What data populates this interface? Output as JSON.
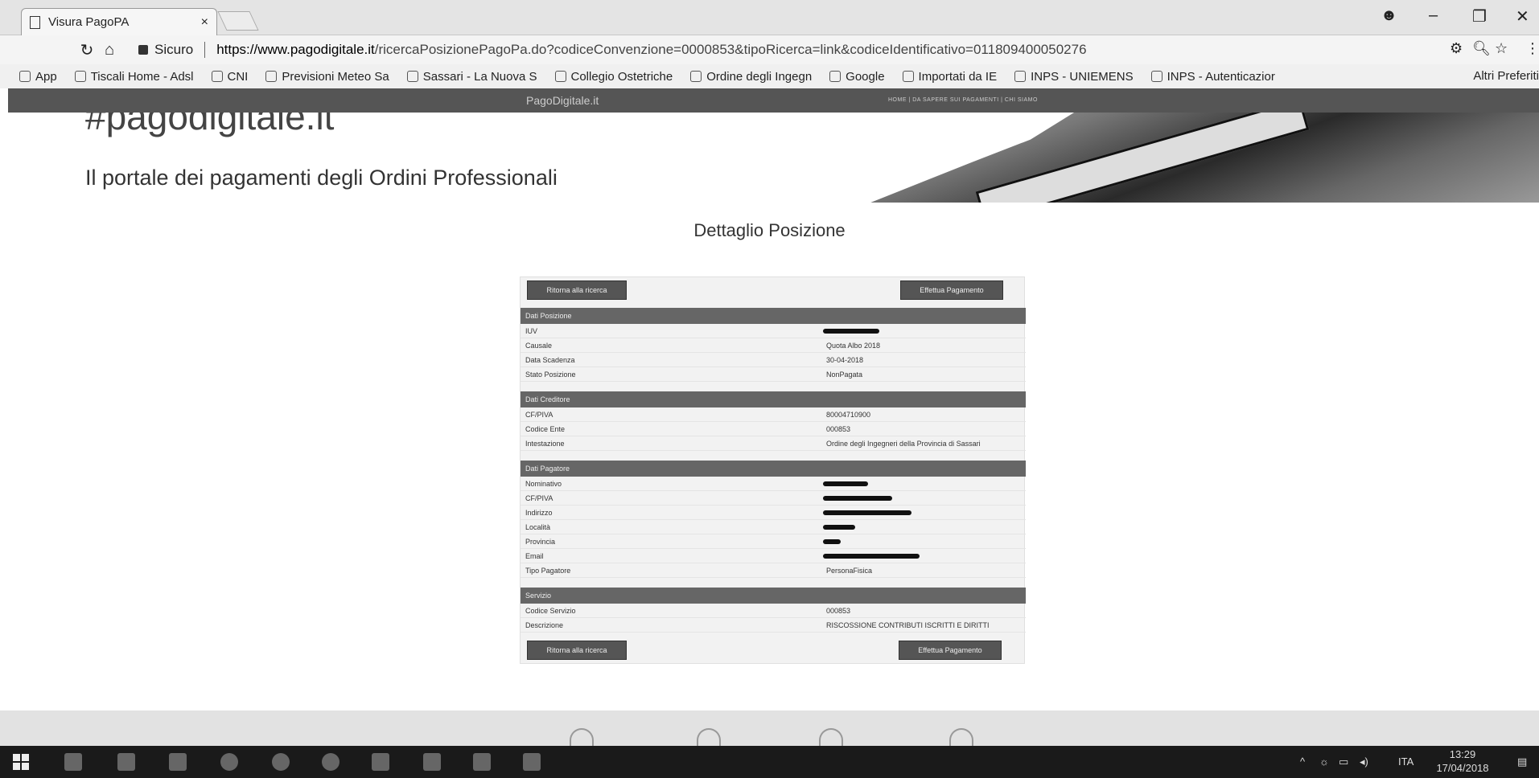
{
  "browser": {
    "tab_title": "Visura PagoPA",
    "tab_close": "×",
    "secure_label": "Sicuro",
    "url_host": "https://www.pagodigitale.it",
    "url_path": "/ricercaPosizionePagoPa.do?codiceConvenzione=0000853&tipoRicerca=link&codiceIdentificativo=011809400050276",
    "bookmarks": [
      "App",
      "Tiscali Home - Adsl",
      "CNI",
      "Previsioni Meteo Sa",
      "Sassari - La Nuova S",
      "Collegio Ostetriche",
      "Ordine degli Ingegn",
      "Google",
      "Importati da IE",
      "INPS - UNIEMENS",
      "INPS - Autenticazior"
    ],
    "bookmarks_more": "Altri Preferiti"
  },
  "site": {
    "brand": "PagoDigitale.it",
    "top_links": "HOME  |  DA SAPERE SUI PAGAMENTI  |  CHI SIAMO",
    "hero_title": "#pagodigitale.it",
    "hero_subtitle": "Il portale dei pagamenti degli Ordini Professionali"
  },
  "page": {
    "title": "Dettaglio Posizione",
    "btn_back": "Ritorna alla ricerca",
    "btn_pay": "Effettua Pagamento"
  },
  "sections": {
    "posizione": {
      "title": "Dati Posizione",
      "rows": [
        {
          "label": "IUV",
          "value": ""
        },
        {
          "label": "Causale",
          "value": "Quota Albo 2018"
        },
        {
          "label": "Data Scadenza",
          "value": "30-04-2018"
        },
        {
          "label": "Stato Posizione",
          "value": "NonPagata"
        }
      ]
    },
    "creditore": {
      "title": "Dati Creditore",
      "rows": [
        {
          "label": "CF/PIVA",
          "value": "80004710900"
        },
        {
          "label": "Codice Ente",
          "value": "000853"
        },
        {
          "label": "Intestazione",
          "value": "Ordine degli Ingegneri della Provincia di Sassari"
        }
      ]
    },
    "pagatore": {
      "title": "Dati Pagatore",
      "rows": [
        {
          "label": "Nominativo",
          "value": ""
        },
        {
          "label": "CF/PIVA",
          "value": ""
        },
        {
          "label": "Indirizzo",
          "value": ""
        },
        {
          "label": "Località",
          "value": ""
        },
        {
          "label": "Provincia",
          "value": ""
        },
        {
          "label": "Email",
          "value": ""
        },
        {
          "label": "Tipo Pagatore",
          "value": "PersonaFisica"
        }
      ]
    },
    "servizio": {
      "title": "Servizio",
      "rows": [
        {
          "label": "Codice Servizio",
          "value": "000853"
        },
        {
          "label": "Descrizione",
          "value": "RISCOSSIONE CONTRIBUTI ISCRITTI E DIRITTI"
        }
      ]
    }
  },
  "taskbar": {
    "lang": "ITA",
    "time": "13:29",
    "date": "17/04/2018"
  }
}
